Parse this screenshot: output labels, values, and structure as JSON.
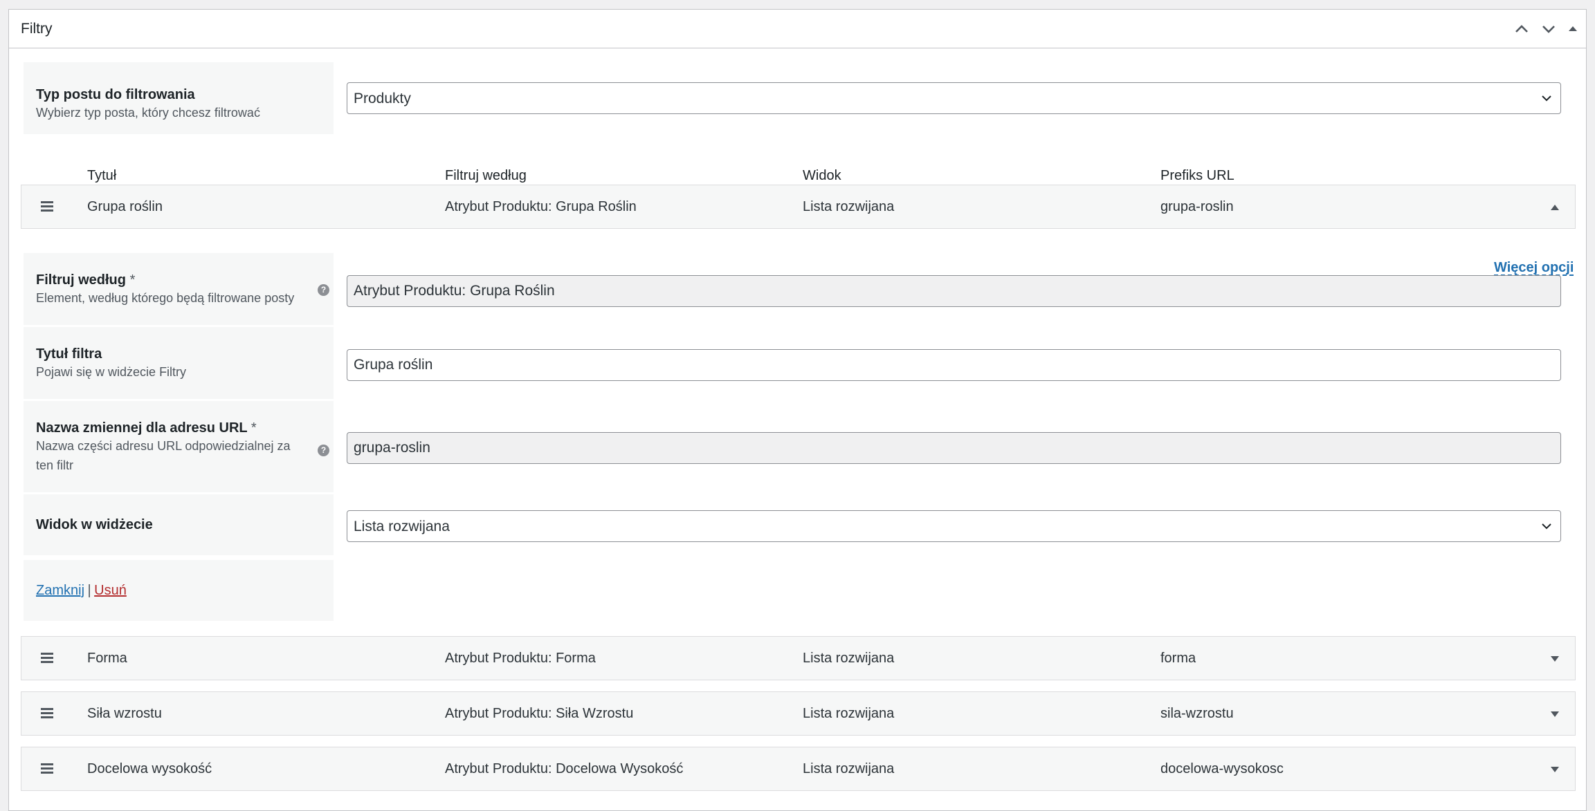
{
  "panel": {
    "title": "Filtry"
  },
  "post_type": {
    "label": "Typ postu do filtrowania",
    "description": "Wybierz typ posta, który chcesz filtrować",
    "value": "Produkty"
  },
  "columns": {
    "title": "Tytuł",
    "filter_by": "Filtruj według",
    "view": "Widok",
    "url_prefix": "Prefiks URL"
  },
  "filters": [
    {
      "title": "Grupa roślin",
      "filter_by": "Atrybut Produktu: Grupa Roślin",
      "view": "Lista rozwijana",
      "url_prefix": "grupa-roslin",
      "expanded": true
    },
    {
      "title": "Forma",
      "filter_by": "Atrybut Produktu: Forma",
      "view": "Lista rozwijana",
      "url_prefix": "forma",
      "expanded": false
    },
    {
      "title": "Siła wzrostu",
      "filter_by": "Atrybut Produktu: Siła Wzrostu",
      "view": "Lista rozwijana",
      "url_prefix": "sila-wzrostu",
      "expanded": false
    },
    {
      "title": "Docelowa wysokość",
      "filter_by": "Atrybut Produktu: Docelowa Wysokość",
      "view": "Lista rozwijana",
      "url_prefix": "docelowa-wysokosc",
      "expanded": false
    }
  ],
  "editor": {
    "more_options": "Więcej opcji",
    "filter_by": {
      "label": "Filtruj według",
      "required": "*",
      "description": "Element, według którego będą filtrowane posty",
      "value": "Atrybut Produktu: Grupa Roślin"
    },
    "filter_title": {
      "label": "Tytuł filtra",
      "description": "Pojawi się w widżecie Filtry",
      "value": "Grupa roślin"
    },
    "url_var": {
      "label": "Nazwa zmiennej dla adresu URL",
      "required": "*",
      "description_line1": "Nazwa części adresu URL odpowiedzialnej za",
      "description_line2": "ten filtr",
      "value": "grupa-roslin"
    },
    "widget_view": {
      "label": "Widok w widżecie",
      "value": "Lista rozwijana"
    },
    "actions": {
      "close": "Zamknij",
      "separator": "|",
      "delete": "Usuń"
    }
  },
  "icons": {
    "move_up": "chevron-up-icon",
    "move_down": "chevron-down-icon",
    "toggle": "triangle-up-icon",
    "drag": "hamburger-drag-icon",
    "help": "question-mark-icon"
  }
}
